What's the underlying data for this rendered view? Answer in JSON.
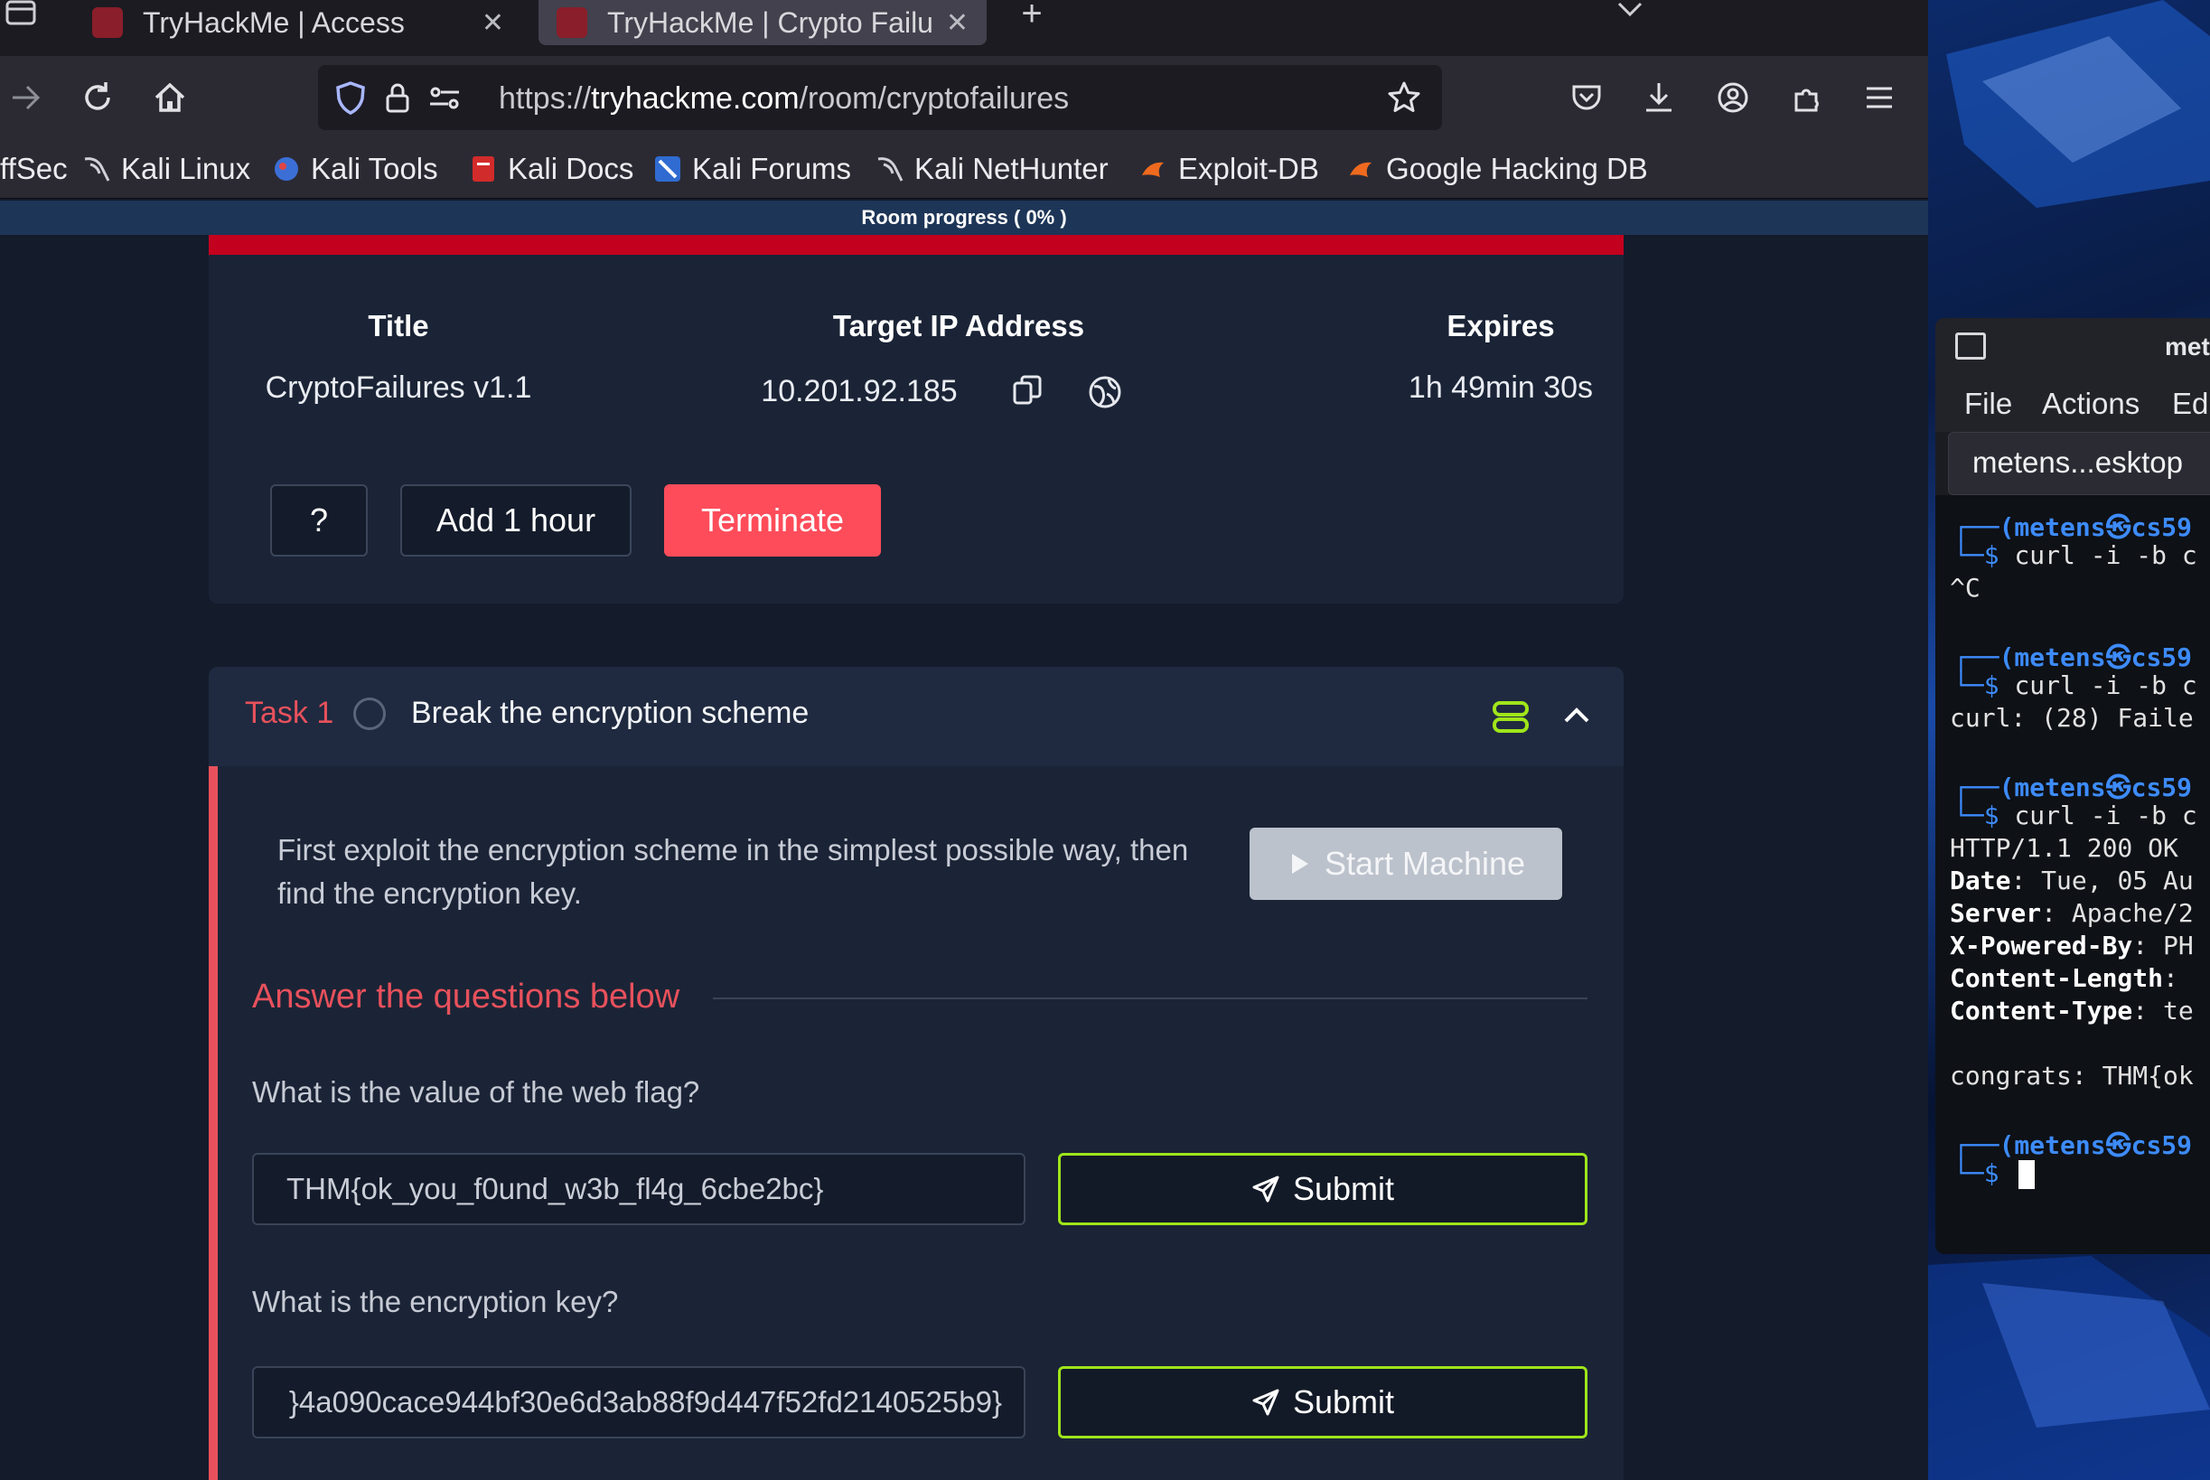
{
  "browser": {
    "tabs": [
      {
        "title": "TryHackMe | Access",
        "active": false
      },
      {
        "title": "TryHackMe | Crypto Failur",
        "active": true
      }
    ],
    "url": {
      "prefix": "https://",
      "host": "tryhackme.com",
      "path": "/room/cryptofailures"
    },
    "bookmarks": [
      "ffSec",
      "Kali Linux",
      "Kali Tools",
      "Kali Docs",
      "Kali Forums",
      "Kali NetHunter",
      "Exploit-DB",
      "Google Hacking DB"
    ]
  },
  "room": {
    "progress_label": "Room progress ( 0% )",
    "progress_percent": 0
  },
  "machine": {
    "headers": {
      "title": "Title",
      "ip": "Target IP Address",
      "expires": "Expires"
    },
    "title": "CryptoFailures v1.1",
    "ip": "10.201.92.185",
    "expires": "1h 49min 30s",
    "help_label": "?",
    "add_hour_label": "Add 1 hour",
    "terminate_label": "Terminate"
  },
  "task": {
    "number_label": "Task 1",
    "title": "Break the encryption scheme",
    "description_line1": "First exploit the encryption scheme in the simplest possible way, then",
    "description_line2": "find the encryption key.",
    "start_machine_label": "Start Machine",
    "answers_heading": "Answer the questions below",
    "questions": [
      {
        "question": "What is the value of the web flag?",
        "answer": "THM{ok_you_f0und_w3b_fl4g_6cbe2bc}",
        "submit_label": "Submit"
      },
      {
        "question": "What is the encryption key?",
        "answer": "}4a090cace944bf30e6d3ab88f9d447f52fd2140525b9}",
        "submit_label": "Submit"
      }
    ]
  },
  "terminal": {
    "window_title": "met",
    "menu": [
      "File",
      "Actions",
      "Ed"
    ],
    "tab_label": "metens...esktop",
    "lines": {
      "p1": "(metens㉿cs59",
      "c1": "curl -i -b c",
      "l_ctrlc": "^C",
      "p2": "(metens㉿cs59",
      "c2": "curl -i -b c",
      "err": "curl: (28) Faile",
      "p3": "(metens㉿cs59",
      "c3": "curl -i -b c",
      "http": "HTTP/1.1 200 OK",
      "date_k": "Date",
      "date_v": ": Tue, 05 Au",
      "server_k": "Server",
      "server_v": ": Apache/2",
      "xpb_k": "X-Powered-By",
      "xpb_v": ": PH",
      "cl_k": "Content-Length",
      "cl_v": ":",
      "ct_k": "Content-Type",
      "ct_v": ": te",
      "congrats": "congrats: THM{ok",
      "p4": "(metens㉿cs59"
    }
  },
  "colors": {
    "accent_red": "#e8515c",
    "submit_green": "#9fe51a",
    "terminate_bg": "#ff4c5a",
    "progress_red": "#c3001e"
  }
}
